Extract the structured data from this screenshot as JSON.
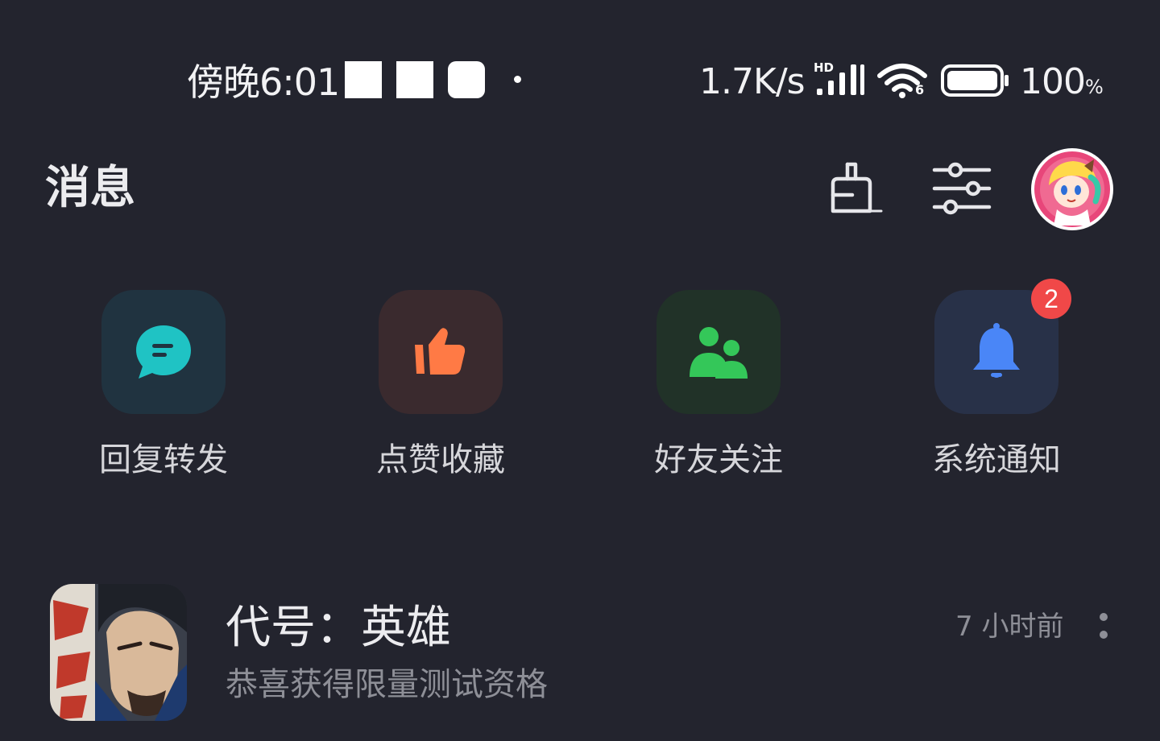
{
  "status_bar": {
    "time": "傍晚6:01",
    "net_speed": "1.7K/s",
    "hd_label": "HD",
    "wifi_generation": "6",
    "battery_number": "100",
    "battery_unit": "%",
    "notification_icons": [
      "white-square-icon",
      "white-square-icon",
      "rounded-square-icon"
    ]
  },
  "header": {
    "title": "消息",
    "clean_icon": "broom-icon",
    "settings_icon": "sliders-icon"
  },
  "categories": [
    {
      "label": "回复转发",
      "icon": "comment-icon",
      "tile_color": "#203340",
      "icon_color": "#1fc3c4"
    },
    {
      "label": "点赞收藏",
      "icon": "thumbs-up-icon",
      "tile_color": "#3a2a2e",
      "icon_color": "#ff7a45"
    },
    {
      "label": "好友关注",
      "icon": "friends-icon",
      "tile_color": "#213228",
      "icon_color": "#34c759"
    },
    {
      "label": "系统通知",
      "icon": "bell-icon",
      "tile_color": "#283148",
      "icon_color": "#4a86f7",
      "badge": "2"
    }
  ],
  "messages": [
    {
      "title": "代号：英雄",
      "subtitle": "恭喜获得限量测试资格",
      "time": "7 小时前"
    }
  ]
}
